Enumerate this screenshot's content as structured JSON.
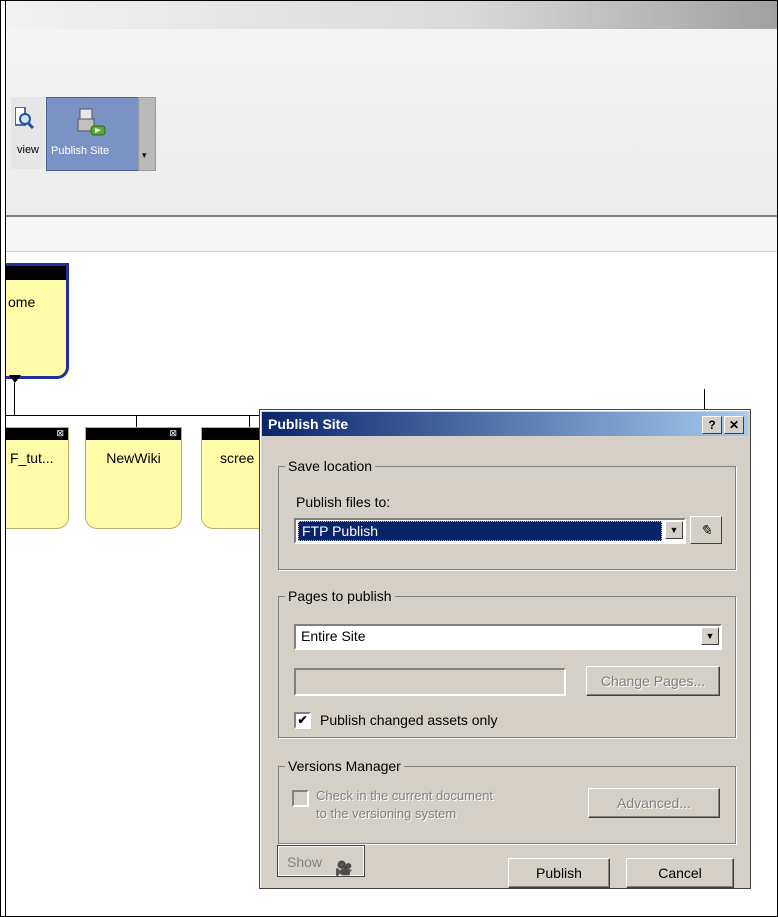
{
  "toolbar": {
    "preview_label": "view",
    "publish_label": "Publish Site",
    "more_glyph": "▾"
  },
  "canvas": {
    "home_label": "ome",
    "nodes": [
      "F_tut...",
      "NewWiki",
      "scree"
    ],
    "node_marker": "⊠"
  },
  "dialog": {
    "title": "Publish Site",
    "help": "?",
    "close": "✕",
    "save_location": {
      "legend": "Save location",
      "label": "Publish files to:",
      "value": "FTP Publish",
      "edit_glyph": "✎"
    },
    "pages": {
      "legend": "Pages to publish",
      "value": "Entire Site",
      "path_value": "",
      "change_label": "Change Pages...",
      "checkbox_label": "Publish changed assets only",
      "checkbox_checked": "✔"
    },
    "versions": {
      "legend": "Versions Manager",
      "check_line1": "Check in the current document",
      "check_line2": "to the versioning system",
      "advanced_label": "Advanced..."
    },
    "show_label": "Show",
    "show_icon": "🎥",
    "publish_label": "Publish",
    "cancel_label": "Cancel"
  },
  "icons": {
    "dropdown": "▼"
  }
}
